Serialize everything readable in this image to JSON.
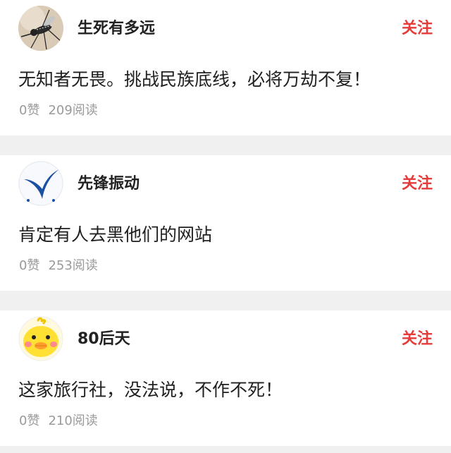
{
  "colors": {
    "follow": "#e63b3b",
    "meta": "#9a9a9a",
    "separator": "#f0f0f0"
  },
  "comments": [
    {
      "avatar": "mosquito-avatar",
      "username": "生死有多远",
      "follow_label": "关注",
      "text": "无知者无畏。挑战民族底线，必将万劫不复！",
      "likes": "0赞",
      "reads": "209阅读"
    },
    {
      "avatar": "blue-wing-logo-avatar",
      "username": "先锋振动",
      "follow_label": "关注",
      "text": "肯定有人去黑他们的网站",
      "likes": "0赞",
      "reads": "253阅读"
    },
    {
      "avatar": "yellow-chick-avatar",
      "username": "80后天",
      "follow_label": "关注",
      "text": "这家旅行社，没法说，不作不死！",
      "likes": "0赞",
      "reads": "210阅读"
    }
  ]
}
